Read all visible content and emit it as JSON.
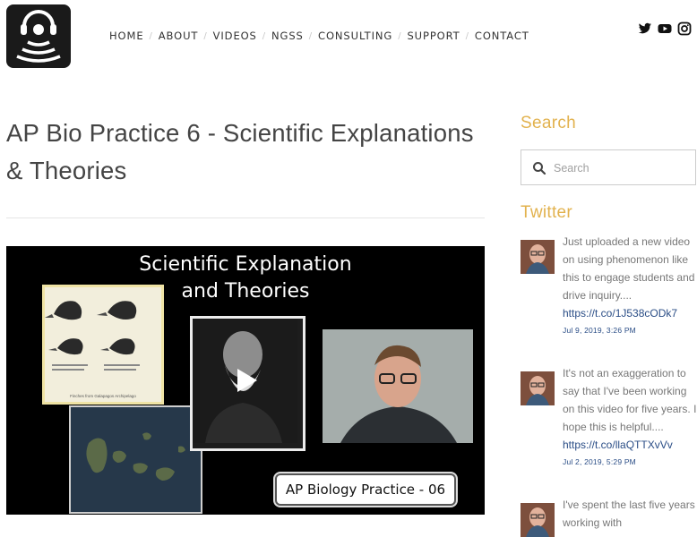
{
  "nav": {
    "items": [
      {
        "label": "HOME"
      },
      {
        "label": "ABOUT"
      },
      {
        "label": "VIDEOS"
      },
      {
        "label": "NGSS"
      },
      {
        "label": "CONSULTING"
      },
      {
        "label": "SUPPORT"
      },
      {
        "label": "CONTACT"
      }
    ],
    "separator": "/"
  },
  "social": {
    "icons": [
      "twitter-icon",
      "youtube-icon",
      "instagram-icon"
    ]
  },
  "post": {
    "title": "AP Bio Practice 6 - Scientific Explanations & Theories"
  },
  "video": {
    "title_line1": "Scientific Explanation",
    "title_line2": "and Theories",
    "finch_caption": "Finches from Galapagos Archipelago",
    "caption": "AP Biology Practice - 06"
  },
  "sidebar": {
    "search_heading": "Search",
    "search_placeholder": "Search",
    "twitter_heading": "Twitter",
    "tweets": [
      {
        "text": "Just uploaded a new video on using phenomenon like this to engage students and drive inquiry....",
        "link": "https://t.co/1J538cODk7",
        "date": "Jul 9, 2019, 3:26 PM"
      },
      {
        "text": "It's not an exaggeration to say that I've been working on this video for five years. I hope this is helpful....",
        "link": "https://t.co/llaQTTXvVv",
        "date": "Jul 2, 2019, 5:29 PM"
      },
      {
        "text": "I've spent the last five years working with",
        "link": "",
        "date": ""
      }
    ]
  },
  "colors": {
    "accent": "#e2b24e",
    "link": "#2a4d86",
    "text": "#777777"
  }
}
